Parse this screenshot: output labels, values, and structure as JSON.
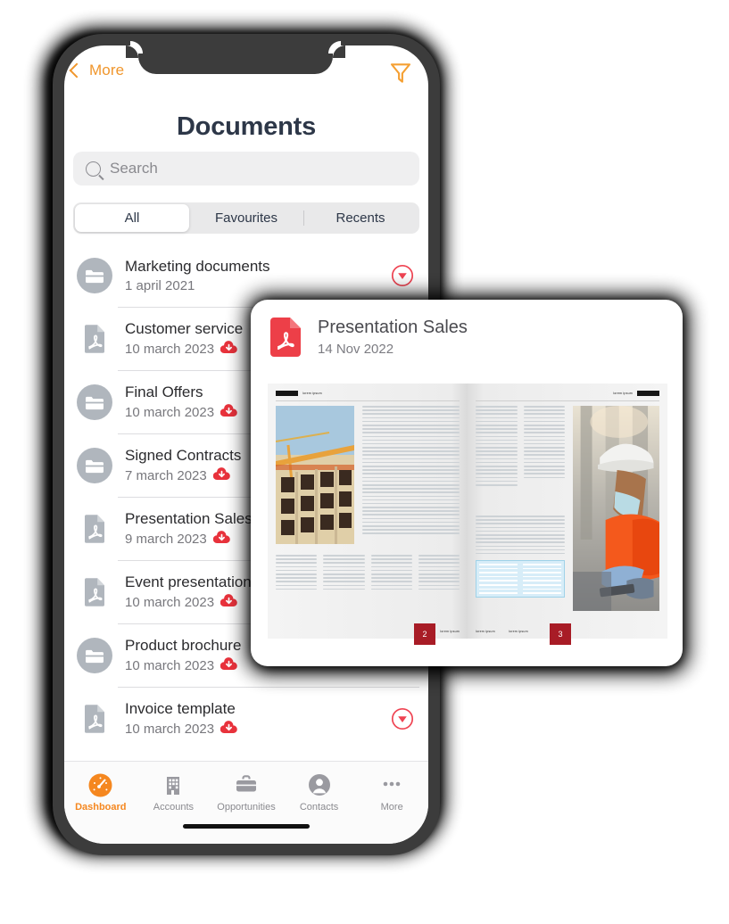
{
  "colors": {
    "accent_orange": "#f5871f",
    "title_navy": "#2d3748",
    "pdf_red": "#ed3f48",
    "badge_red": "#e8323c",
    "page_num_red": "#a81c26",
    "phone_frame": "#3c3c3c",
    "folder_gray": "#adb3ba"
  },
  "phone": {
    "navbar": {
      "back_label": "More",
      "back_icon": "chevron-left-icon",
      "filter_icon": "filter-funnel-icon"
    },
    "page_title": "Documents",
    "search": {
      "placeholder": "Search",
      "value": "",
      "icon": "search-icon"
    },
    "segments": [
      {
        "label": "All",
        "active": true
      },
      {
        "label": "Favourites",
        "active": false
      },
      {
        "label": "Recents",
        "active": false
      }
    ],
    "documents": [
      {
        "title": "Marketing documents",
        "date": "1 april 2021",
        "type": "folder",
        "downloaded": false,
        "action": "expand-chevron-icon"
      },
      {
        "title": "Customer service",
        "date": "10 march 2023",
        "type": "pdf",
        "downloaded": true,
        "action": ""
      },
      {
        "title": "Final Offers",
        "date": "10 march 2023",
        "type": "folder",
        "downloaded": true,
        "action": ""
      },
      {
        "title": "Signed Contracts",
        "date": "7 march 2023",
        "type": "folder",
        "downloaded": true,
        "action": ""
      },
      {
        "title": "Presentation Sales",
        "date": "9 march 2023",
        "type": "pdf",
        "downloaded": true,
        "action": ""
      },
      {
        "title": "Event presentation",
        "date": "10 march 2023",
        "type": "pdf",
        "downloaded": true,
        "action": ""
      },
      {
        "title": "Product brochure",
        "date": "10 march 2023",
        "type": "folder",
        "downloaded": true,
        "action": ""
      },
      {
        "title": "Invoice template",
        "date": "10 march 2023",
        "type": "pdf",
        "downloaded": true,
        "action": "expand-chevron-icon"
      }
    ],
    "tabbar": [
      {
        "label": "Dashboard",
        "icon": "dashboard-gauge-icon",
        "active": true
      },
      {
        "label": "Accounts",
        "icon": "building-icon",
        "active": false
      },
      {
        "label": "Opportunities",
        "icon": "briefcase-icon",
        "active": false
      },
      {
        "label": "Contacts",
        "icon": "person-circle-icon",
        "active": false
      },
      {
        "label": "More",
        "icon": "ellipsis-icon",
        "active": false
      }
    ]
  },
  "preview_card": {
    "file_icon": "pdf-file-icon",
    "title": "Presentation Sales",
    "date": "14 Nov 2022",
    "spread": {
      "left_page": {
        "header_text": "lorem ipsum",
        "page_number": "2",
        "footer_text": "lorem ipsum"
      },
      "right_page": {
        "header_text": "lorem ipsum",
        "page_number": "3",
        "footer_left": "lorem ipsum",
        "footer_right": "lorem ipsum"
      }
    }
  }
}
